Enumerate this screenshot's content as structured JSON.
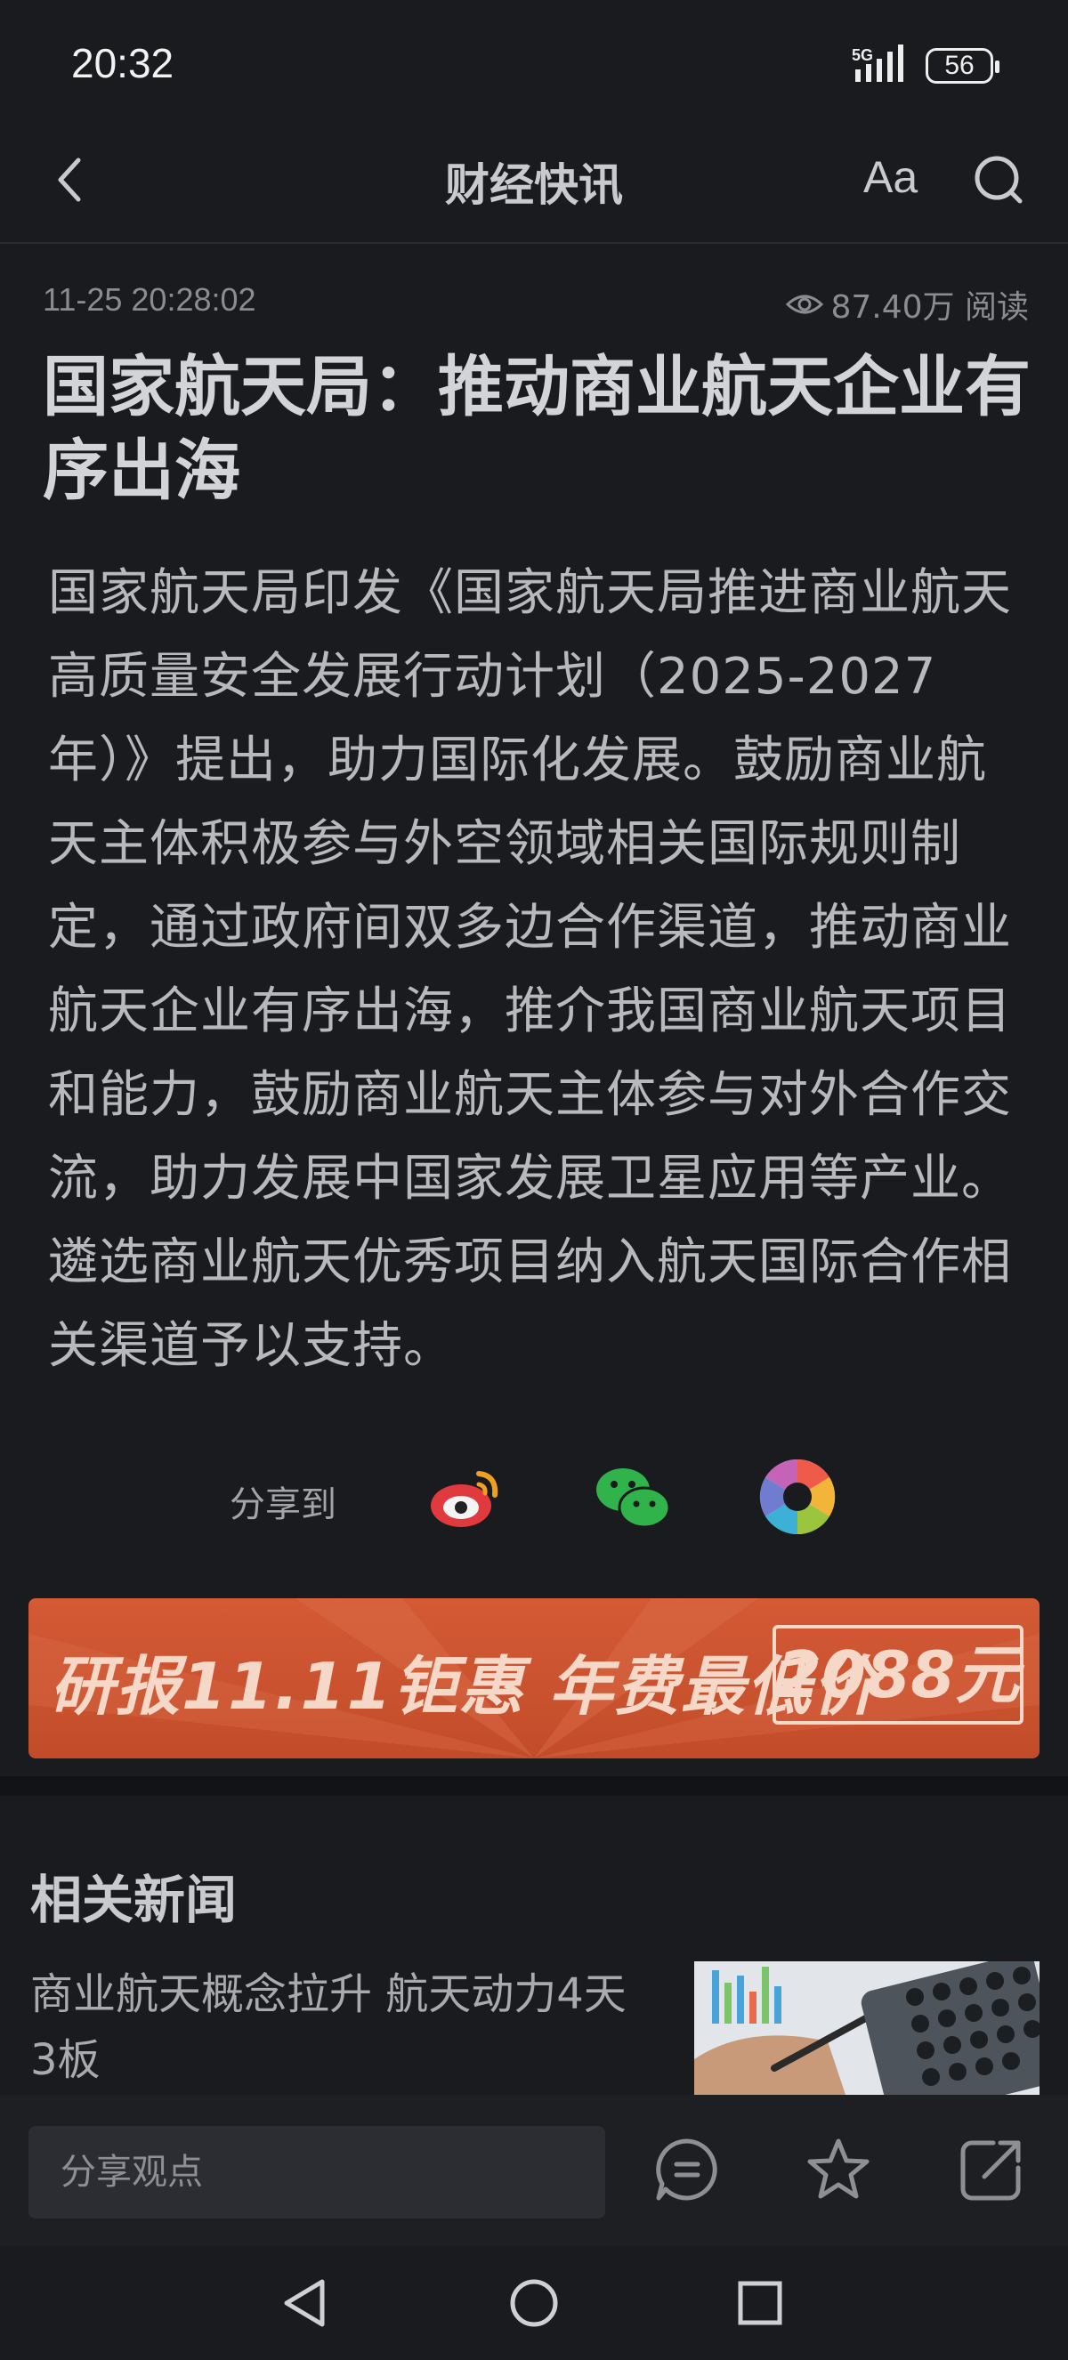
{
  "status_bar": {
    "time": "20:32",
    "network": "5G",
    "battery": "56"
  },
  "nav": {
    "title": "财经快讯",
    "font_size_label": "Aa"
  },
  "article": {
    "timestamp": "11-25 20:28:02",
    "views": "87.40万 阅读",
    "headline": "国家航天局：推动商业航天企业有序出海",
    "body": "国家航天局印发《国家航天局推进商业航天高质量安全发展行动计划（2025-2027年）》提出，助力国际化发展。鼓励商业航天主体积极参与外空领域相关国际规则制定，通过政府间双多边合作渠道，推动商业航天企业有序出海，推介我国商业航天项目和能力，鼓励商业航天主体参与对外合作交流，助力发展中国家发展卫星应用等产业。遴选商业航天优秀项目纳入航天国际合作相关渠道予以支持。"
  },
  "share": {
    "label": "分享到",
    "targets": [
      "weibo-icon",
      "wechat-icon",
      "moments-icon"
    ]
  },
  "promo": {
    "text": "研报11.11钜惠 年费最低价",
    "price": "2088元"
  },
  "related": {
    "title": "相关新闻",
    "items": [
      {
        "title": "商业航天概念拉升 航天动力4天3板"
      }
    ]
  },
  "bottom_bar": {
    "comment_placeholder": "分享观点"
  },
  "colors": {
    "background": "#1a1b1f",
    "promo_bg": "#c24c2a",
    "headline": "#d3d4d8"
  }
}
